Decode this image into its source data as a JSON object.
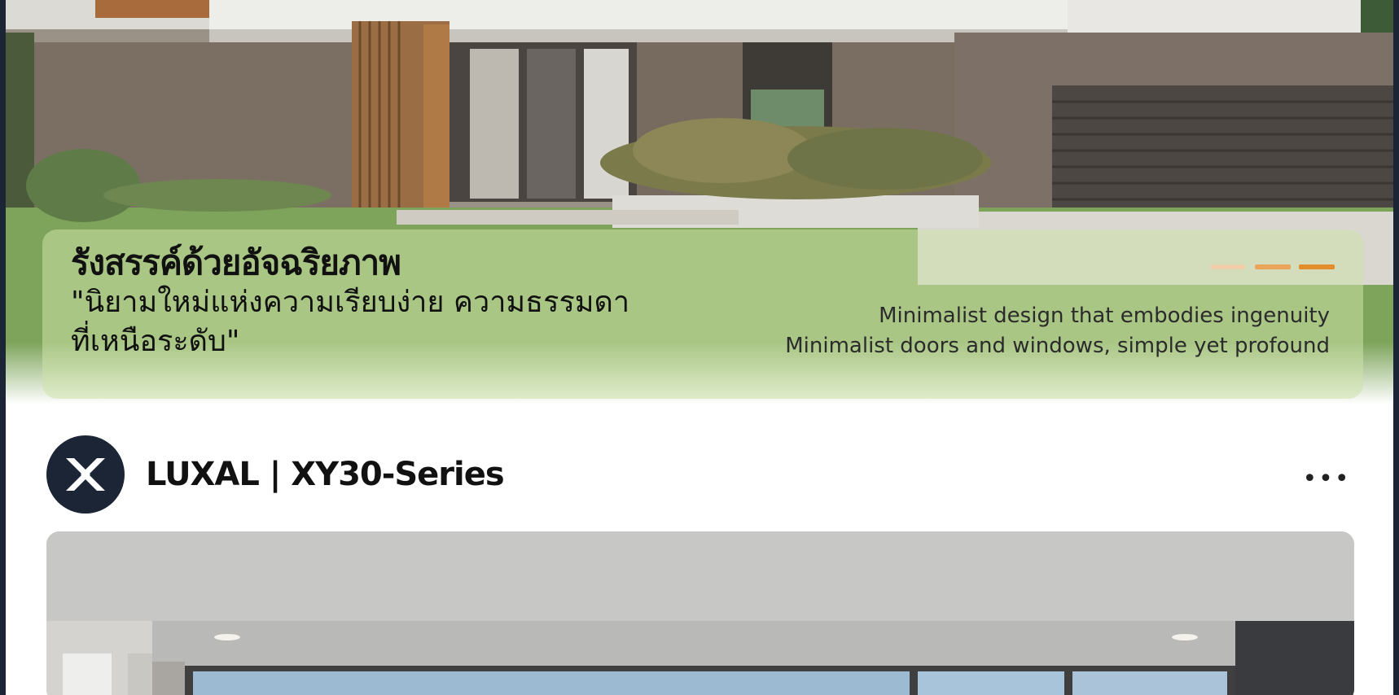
{
  "hero": {
    "headline": "รังสรรค์ด้วยอัจฉริยภาพ",
    "subhead": "\"นิยามใหม่แห่งความเรียบง่าย ความธรรมดาที่เหนือระดับ\"",
    "tagline_1": "Minimalist design that embodies ingenuity",
    "tagline_2": "Minimalist doors and windows, simple yet profound",
    "slide_count": 3,
    "active_slide": 3,
    "image_subject": "modern-minimalist-house-facade"
  },
  "brand": {
    "name": "LUXAL | XY30-Series",
    "logo_icon": "x-mark-icon",
    "more_label": "•••"
  },
  "interior": {
    "image_subject": "minimalist-interior-with-large-windows"
  },
  "colors": {
    "frame_border": "#1b2535",
    "accent_orange": "#e48d2c",
    "caption_overlay": "#cde1aa"
  }
}
